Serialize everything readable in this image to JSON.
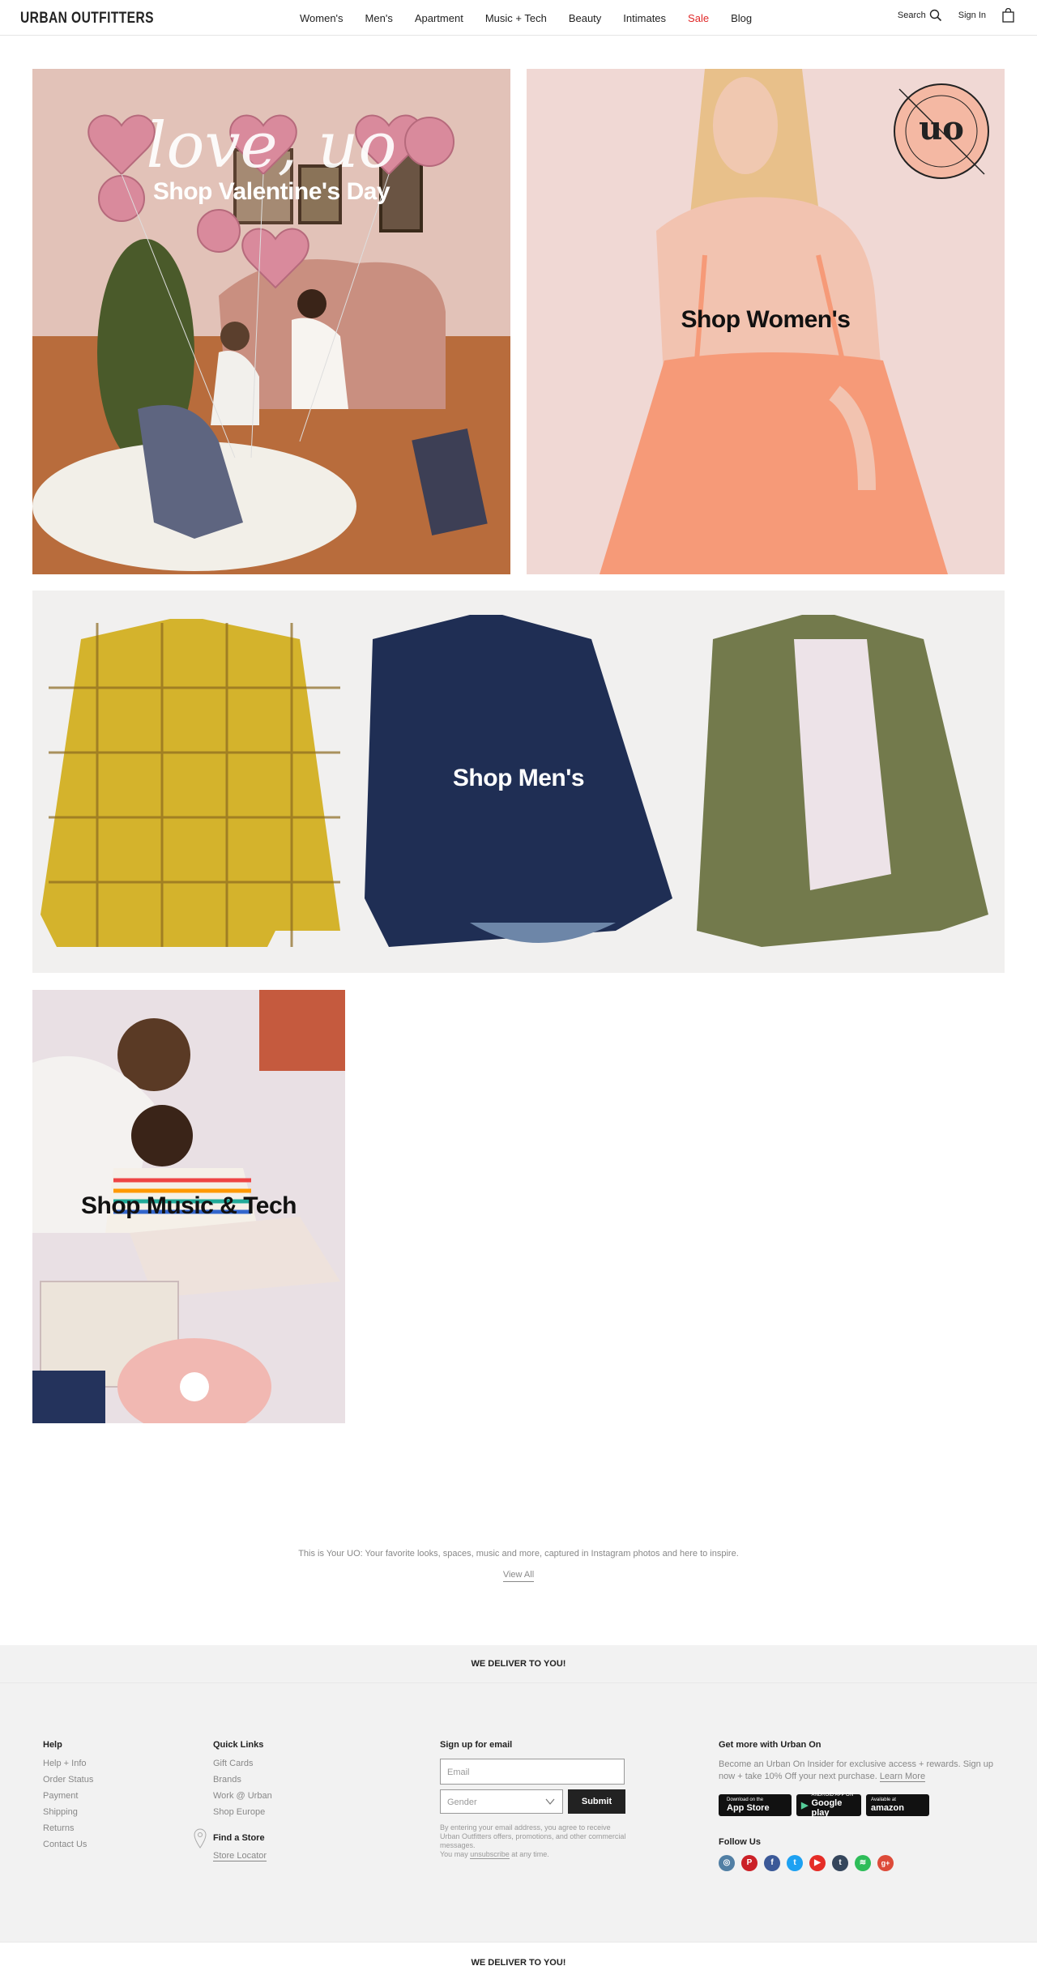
{
  "header": {
    "logo": "URBAN OUTFITTERS",
    "nav": [
      "Women's",
      "Men's",
      "Apartment",
      "Music + Tech",
      "Beauty",
      "Intimates",
      "Sale",
      "Blog"
    ],
    "search_label": "Search",
    "signin_label": "Sign In"
  },
  "tiles": {
    "valentines": {
      "label": "Shop Valentine's Day",
      "script_text": "love, uo"
    },
    "womens": {
      "label": "Shop Women's",
      "stamp_text": "URBAN OUTFITTERS"
    },
    "mens": {
      "label": "Shop Men's"
    },
    "music": {
      "label": "Shop Music & Tech"
    }
  },
  "your_uo": {
    "text": "This is Your UO: Your favorite looks, spaces, music and more, captured in Instagram photos and here to inspire.",
    "view_all": "View All"
  },
  "deliver_text": "WE DELIVER TO YOU!",
  "footer": {
    "help": {
      "title": "Help",
      "links": [
        "Help + Info",
        "Order Status",
        "Payment",
        "Shipping",
        "Returns",
        "Contact Us"
      ]
    },
    "quick_links": {
      "title": "Quick Links",
      "links": [
        "Gift Cards",
        "Brands",
        "Work @ Urban",
        "Shop Europe"
      ]
    },
    "store": {
      "title": "Find a Store",
      "link": "Store Locator"
    },
    "email": {
      "title": "Sign up for email",
      "placeholder": "Email",
      "gender": "Gender",
      "submit": "Submit",
      "legal_1": "By entering your email address, you agree to receive Urban Outfitters offers, promotions, and other commercial messages.",
      "legal_2": "You may ",
      "legal_link": "unsubscribe",
      "legal_3": " at any time."
    },
    "urban_on": {
      "title": "Get more with Urban On",
      "text": "Become an Urban On Insider for exclusive access + rewards. Sign up now + take 10% Off your next purchase. ",
      "learn_more": "Learn More",
      "badges": [
        {
          "small": "Download on the",
          "big": "App Store"
        },
        {
          "small": "ANDROID APP ON",
          "big": "Google play"
        },
        {
          "small": "Available at",
          "big": "amazon"
        }
      ],
      "follow_title": "Follow Us",
      "socials": [
        {
          "icon": "instagram-icon",
          "glyph": "◎",
          "color": "#517fa4"
        },
        {
          "icon": "pinterest-icon",
          "glyph": "P",
          "color": "#cb2027"
        },
        {
          "icon": "facebook-icon",
          "glyph": "f",
          "color": "#3b5998"
        },
        {
          "icon": "twitter-icon",
          "glyph": "t",
          "color": "#1da1f2"
        },
        {
          "icon": "youtube-icon",
          "glyph": "▶",
          "color": "#e52d27"
        },
        {
          "icon": "tumblr-icon",
          "glyph": "t",
          "color": "#35465c"
        },
        {
          "icon": "spotify-icon",
          "glyph": "≋",
          "color": "#2ebd59"
        },
        {
          "icon": "googleplus-icon",
          "glyph": "g+",
          "color": "#dd4b39"
        }
      ]
    }
  }
}
